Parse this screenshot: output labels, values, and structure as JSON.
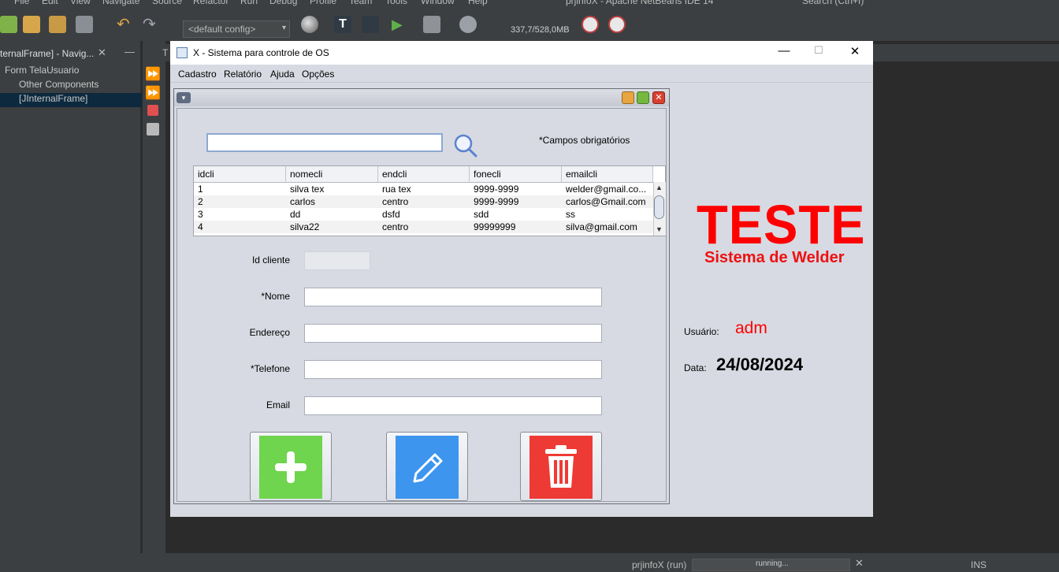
{
  "ide": {
    "menu": [
      "File",
      "Edit",
      "View",
      "Navigate",
      "Source",
      "Refactor",
      "Run",
      "Debug",
      "Profile",
      "Team",
      "Tools",
      "Window",
      "Help"
    ],
    "window_title": "prjinfoX - Apache NetBeans IDE 14",
    "search_placeholder": "Search (Ctrl+I)",
    "config": "<default config>",
    "memory": "337,7/528,0MB",
    "navigator_title": "ternalFrame] - Navig...",
    "tree": [
      "Form TelaUsuario",
      "Other Components",
      "[JInternalFrame]"
    ],
    "editor_tab": "T",
    "status_project": "prjinfoX (run)",
    "status_progress": "running...",
    "status_mode": "INS"
  },
  "app": {
    "title": "X - Sistema para controle de OS",
    "menu": [
      "Cadastro",
      "Relatório",
      "Ajuda",
      "Opções"
    ],
    "search": {
      "value": "",
      "placeholder": ""
    },
    "required_note": "*Campos obrigatórios",
    "table": {
      "columns": [
        "idcli",
        "nomecli",
        "endcli",
        "fonecli",
        "emailcli"
      ],
      "rows": [
        [
          "1",
          "silva tex",
          "rua tex",
          "9999-9999",
          "welder@gmail.co..."
        ],
        [
          "2",
          "carlos",
          "centro",
          "9999-9999",
          "carlos@Gmail.com"
        ],
        [
          "3",
          "dd",
          "dsfd",
          "sdd",
          "ss"
        ],
        [
          "4",
          "silva22",
          "centro",
          "99999999",
          "silva@gmail.com"
        ]
      ]
    },
    "form": {
      "id_label": "Id cliente",
      "name_label": "*Nome",
      "address_label": "Endereço",
      "phone_label": "*Telefone",
      "email_label": "Email"
    },
    "buttons": {
      "add": "add-icon",
      "edit": "pencil-icon",
      "delete": "trash-icon"
    },
    "brand_title": "TESTE",
    "brand_subtitle": "Sistema de Welder",
    "user_label": "Usuário:",
    "user_value": "adm",
    "date_label": "Data:",
    "date_value": "24/08/2024",
    "colors": {
      "add": "#6fd44e",
      "edit": "#3d95ee",
      "delete": "#ee3a35",
      "brand": "#ff0000"
    }
  }
}
